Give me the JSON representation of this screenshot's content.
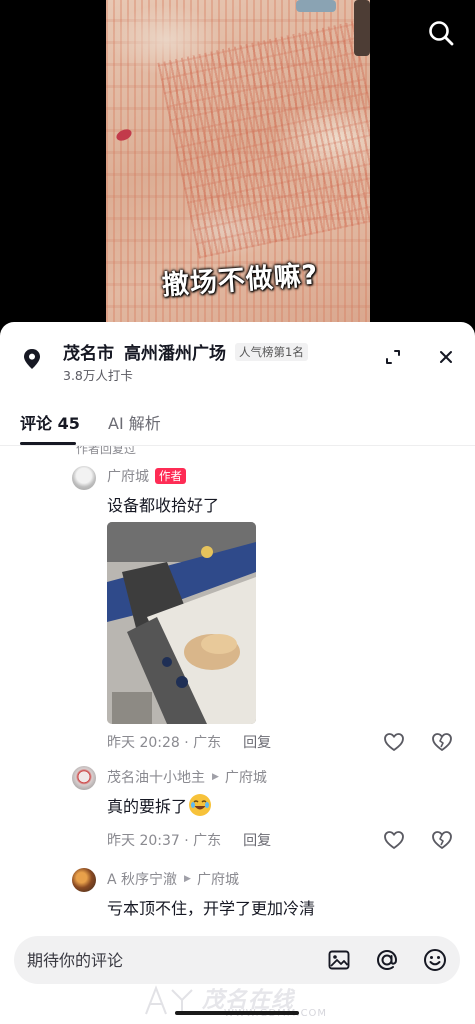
{
  "video": {
    "caption": "撤场不做嘛?"
  },
  "location": {
    "city": "茂名市",
    "place": "高州潘州广场",
    "rank_badge": "人气榜第1名",
    "checkins": "3.8万人打卡"
  },
  "tabs": [
    {
      "label": "评论 45"
    },
    {
      "label": "AI 解析"
    }
  ],
  "reply_hint": "作者回复过",
  "comments": [
    {
      "user": "广府城",
      "author_tag": "作者",
      "text": "设备都收拾好了",
      "meta_time": "昨天 20:28 · 广东",
      "reply_label": "回复"
    },
    {
      "user": "茂名油十小地主",
      "reply_to": "广府城",
      "text": "真的要拆了",
      "meta_time": "昨天 20:37 · 广东",
      "reply_label": "回复"
    },
    {
      "user": "A 秋序宁澈",
      "reply_to": "广府城",
      "text": "亏本顶不住，开学了更加冷清"
    }
  ],
  "input": {
    "placeholder": "期待你的评论"
  },
  "watermark": {
    "text": "茂名在线",
    "url": "WWW.GDMM.COM"
  },
  "icons": [
    "search-icon",
    "location-pin-icon",
    "expand-icon",
    "close-icon",
    "like-icon",
    "dislike-icon",
    "image-icon",
    "at-icon",
    "emoji-icon"
  ]
}
